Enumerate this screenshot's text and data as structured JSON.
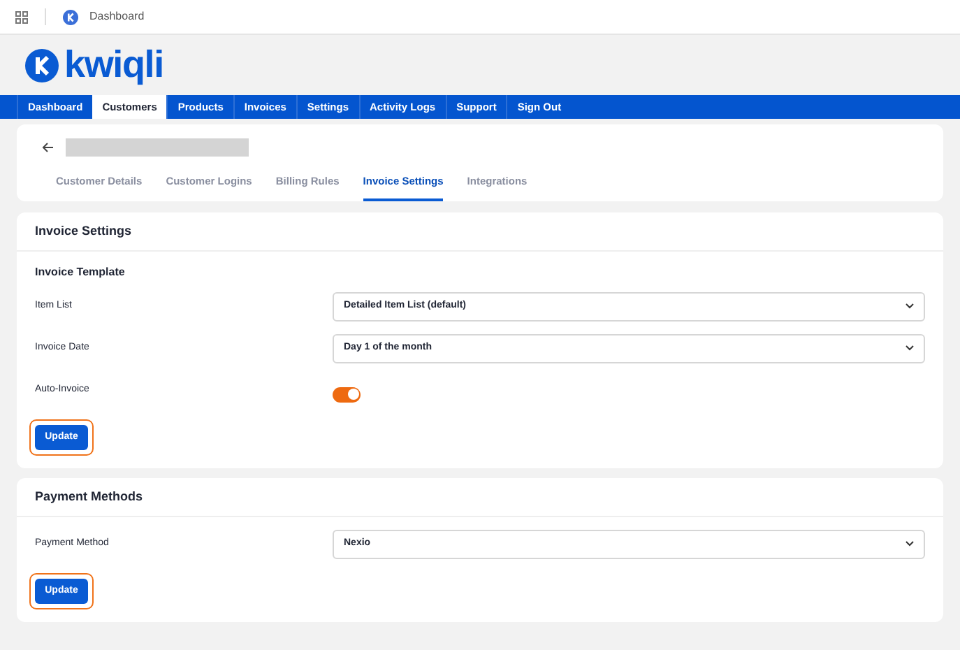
{
  "browser_tab": {
    "title": "Dashboard"
  },
  "brand": {
    "name": "kwiqli"
  },
  "nav": [
    {
      "label": "Dashboard",
      "selected": false
    },
    {
      "label": "Customers",
      "selected": true
    },
    {
      "label": "Products",
      "selected": false
    },
    {
      "label": "Invoices",
      "selected": false
    },
    {
      "label": "Settings",
      "selected": false
    },
    {
      "label": "Activity Logs",
      "selected": false
    },
    {
      "label": "Support",
      "selected": false
    },
    {
      "label": "Sign Out",
      "selected": false
    }
  ],
  "customer_tabs": [
    {
      "label": "Customer Details",
      "selected": false
    },
    {
      "label": "Customer Logins",
      "selected": false
    },
    {
      "label": "Billing Rules",
      "selected": false
    },
    {
      "label": "Invoice Settings",
      "selected": true
    },
    {
      "label": "Integrations",
      "selected": false
    }
  ],
  "sections": [
    {
      "title": "Invoice Settings",
      "subtitle": "Invoice Template",
      "fields": [
        {
          "kind": "select",
          "label": "Item List",
          "value": "Detailed Item List (default)"
        },
        {
          "kind": "select",
          "label": "Invoice Date",
          "value": "Day 1 of the month"
        },
        {
          "kind": "toggle",
          "label": "Auto-Invoice",
          "on": true
        }
      ],
      "button": {
        "label": "Update",
        "highlighted": true
      }
    },
    {
      "title": "Payment Methods",
      "fields": [
        {
          "kind": "select",
          "label": "Payment Method",
          "value": "Nexio"
        }
      ],
      "button": {
        "label": "Update",
        "highlighted": true
      }
    }
  ]
}
